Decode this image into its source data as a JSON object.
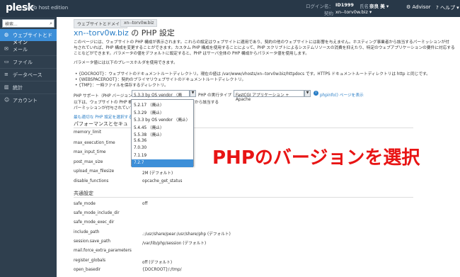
{
  "header": {
    "logo": "plesk",
    "edition": "web host edition",
    "login_label": "ログイン名：",
    "login_value": "ID1999",
    "name_label": "氏名",
    "name_value": "奈良 美 ▾",
    "contract_label": "契約",
    "contract_value": "xn--torv0w.biz ▾",
    "advisor": "Advisor",
    "help": "ヘルプ ▾"
  },
  "sidebar": {
    "search_placeholder": "検索...",
    "items": [
      {
        "label": "ウェブサイトとドメイン"
      },
      {
        "label": "メール"
      },
      {
        "label": "ファイル"
      },
      {
        "label": "データベース"
      },
      {
        "label": "統計"
      },
      {
        "label": "アカウント"
      }
    ]
  },
  "main": {
    "breadcrumbs": [
      "ウェブサイトとドメイン",
      "xn--torv0w.biz"
    ],
    "title_domain": "xn--torv0w.biz",
    "title_rest": " の PHP 設定",
    "intro_lines": [
      "このページには、ウェブサイトの PHP 構成が表示されます。これらの設定はウェブサイトに適用であり、契約の他のウェブサイトには影響を与えません。ホスティング事業者から該当するパーミッションが付",
      "与されていれば、PHP 構成を変更することができます。カスタム PHP 構成を使用することによって、PHP スクリプトによるシステムリソースの消費を抑えたり、特定のウェブアプリケーションの要件に対応する",
      "ことなどができます。パラメータの値をデフォルトに設定すると、PHP はサーバ全体の PHP 構成からパラメータ値を使用します。"
    ],
    "placeholder_line": "パラメータ値には以下のプレースホルダを使用できます。",
    "bullets": [
      "• {DOCROOT}：ウェブサイトのドキュメントルートディレクトリ。現在の値は /var/www/vhosts/xn--torv0w.biz/httpdocs です。HTTPS ドキュメントルートディレクトリは http と同じです。",
      "• {WEBSPACEROOT}：契約のプライマリウェブサイトのドキュメントルートディレクトリ。",
      "• {TMP}：一時ファイルを保存するディレクトリ。"
    ],
    "php_support_label": "PHP サポート（PHP バージョン",
    "php_version_selected": "5.3.3 by OS vendor （廃止）",
    "php_exec_label": "PHP の実行タイプ",
    "php_exec_selected": "FastCGI アプリケーション + Apache",
    "phpinfo_link": "phpinfo() ページを表示",
    "note_line1_a": "以下は、ウェブサイトの PHP 機",
    "note_line1_b": "から該当する",
    "note_line2_a": "パーミッションが付与されていて",
    "note_line3": "最も適切な PHP 設定を選択する",
    "section_perf": "パフォーマンスとセキュ",
    "perf_rows": [
      {
        "label": "memory_limit",
        "value": ""
      },
      {
        "label": "max_execution_time",
        "value": ""
      },
      {
        "label": "max_input_time",
        "value": ""
      },
      {
        "label": "post_max_size",
        "value": ""
      },
      {
        "label": "upload_max_filesize",
        "value": "2M (デフォルト)"
      },
      {
        "label": "disable_functions",
        "value": "opcache_get_status"
      }
    ],
    "section_common": "共通設定",
    "common_rows": [
      {
        "label": "safe_mode",
        "value": "off"
      },
      {
        "label": "safe_mode_include_dir",
        "value": ""
      },
      {
        "label": "safe_mode_exec_dir",
        "value": ""
      },
      {
        "label": "include_path",
        "value": ".:/usr/share/pear:/usr/share/php (デフォルト)"
      },
      {
        "label": "session.save_path",
        "value": "/var/lib/php/session (デフォルト)"
      },
      {
        "label": "mail.force_extra_parameters",
        "value": ""
      },
      {
        "label": "register_globals",
        "value": "off (デフォルト)"
      },
      {
        "label": "open_basedir",
        "value": "{DOCROOT}/:/tmp/"
      }
    ]
  },
  "dropdown": {
    "options": [
      "5.2.17 （廃止）",
      "5.3.29 （廃止）",
      "5.3.3 by OS vendor （廃止）",
      "5.4.45 （廃止）",
      "5.5.38 （廃止）",
      "5.6.36",
      "7.0.30",
      "7.1.19",
      "7.2.7"
    ],
    "selected_index": 8
  },
  "overlay": {
    "text": "PHPのバージョンを選択",
    "color": "#e81414"
  },
  "colors": {
    "header_bg": "#283848",
    "sidebar_bg": "#2f3f4e",
    "accent": "#3d8fd8"
  }
}
